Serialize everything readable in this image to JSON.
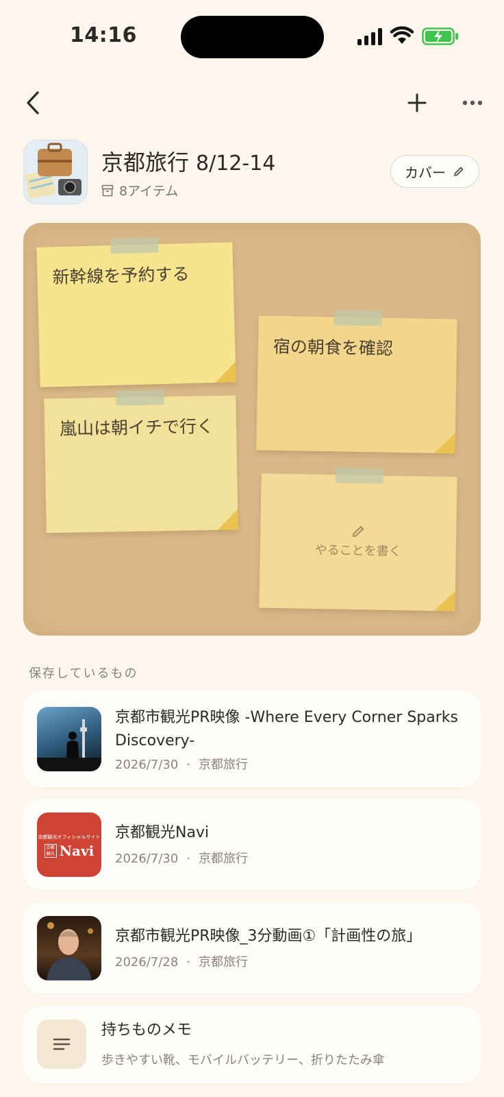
{
  "status": {
    "time": "14:16"
  },
  "header": {
    "title": "京都旅行",
    "date": "8/12-14",
    "item_count": "8アイテム",
    "cover_label": "カバー"
  },
  "board": {
    "notes": [
      {
        "text": "新幹線を予約する"
      },
      {
        "text": "宿の朝食を確認"
      },
      {
        "text": "嵐山は朝イチで行く"
      }
    ],
    "add_note_label": "やることを書く"
  },
  "saved": {
    "section_label": "保存しているもの",
    "items": [
      {
        "title": "京都市観光PR映像 -Where Every Corner Sparks Discovery-",
        "date": "2026/7/30",
        "folder": "京都旅行"
      },
      {
        "title": "京都観光Navi",
        "date": "2026/7/30",
        "folder": "京都旅行"
      },
      {
        "title": "京都市観光PR映像_3分動画①「計画性の旅」",
        "date": "2026/7/28",
        "folder": "京都旅行"
      }
    ],
    "memo": {
      "title": "持ちものメモ",
      "body": "歩きやすい靴、モバイルバッテリー、折りたたみ傘"
    }
  },
  "thumb_texts": {
    "navi_small": "京都観光オフィシャルサイト",
    "navi_badge": "京都観光",
    "navi_big": "Navi"
  },
  "colors": {
    "background": "#fcf6ec",
    "board": "#d9b988",
    "note_yellow": "#f7e48f",
    "battery": "#3fc54d",
    "navi_red": "#cf4334"
  }
}
